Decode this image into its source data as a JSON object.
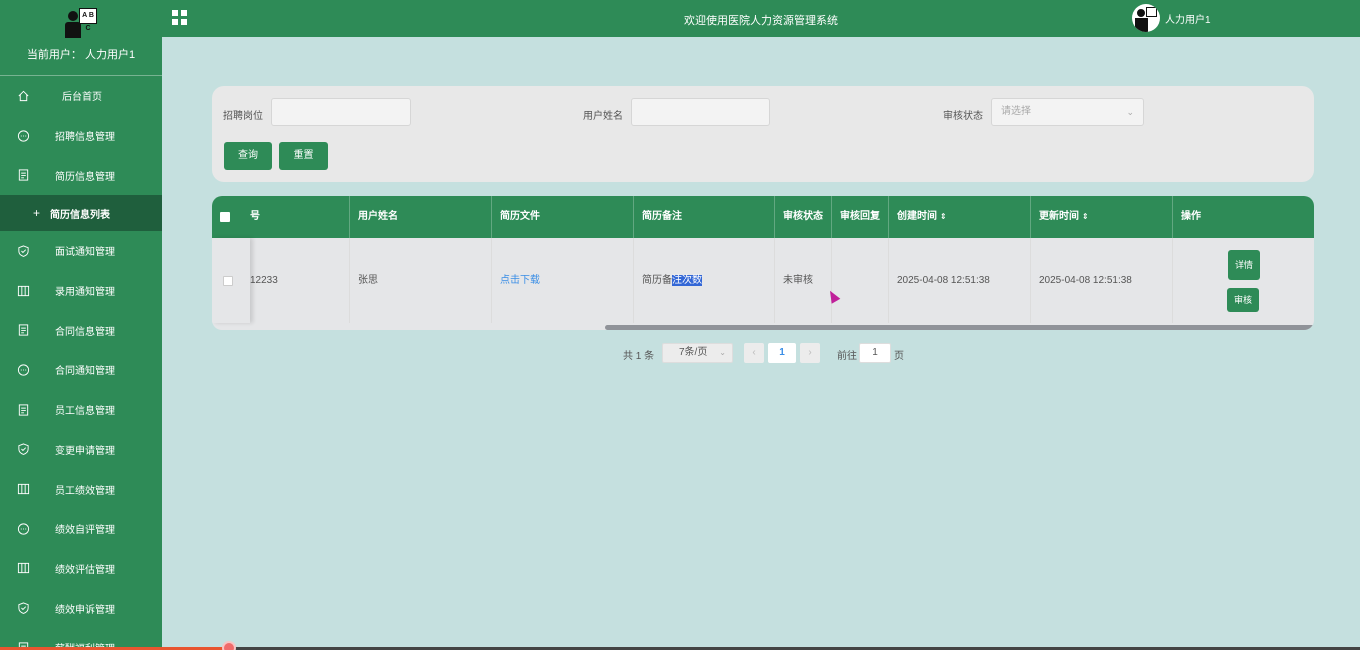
{
  "sidebar": {
    "current_user": "当前用户：  人力用户1",
    "logo_board": "A B C",
    "items": [
      {
        "label": "后台首页",
        "icon": "home-icon"
      },
      {
        "label": "招聘信息管理",
        "icon": "chat-bubble-icon"
      },
      {
        "label": "简历信息管理",
        "icon": "document-icon"
      },
      {
        "label": "面试通知管理",
        "icon": "shield-check-icon"
      },
      {
        "label": "录用通知管理",
        "icon": "columns-icon"
      },
      {
        "label": "合同信息管理",
        "icon": "document-icon"
      },
      {
        "label": "合同通知管理",
        "icon": "chat-bubble-icon"
      },
      {
        "label": "员工信息管理",
        "icon": "document-icon"
      },
      {
        "label": "变更申请管理",
        "icon": "shield-check-icon"
      },
      {
        "label": "员工绩效管理",
        "icon": "columns-icon"
      },
      {
        "label": "绩效自评管理",
        "icon": "chat-bubble-icon"
      },
      {
        "label": "绩效评估管理",
        "icon": "columns-icon"
      },
      {
        "label": "绩效申诉管理",
        "icon": "shield-check-icon"
      },
      {
        "label": "薪酬福利管理",
        "icon": "document-icon"
      }
    ],
    "sub_item": {
      "plus": "+",
      "label": "简历信息列表"
    }
  },
  "header": {
    "title": "欢迎使用医院人力资源管理系统",
    "user_name": "人力用户1"
  },
  "search": {
    "position_label": "招聘岗位",
    "position_value": "",
    "username_label": "用户姓名",
    "username_value": "",
    "status_label": "审核状态",
    "status_placeholder": "请选择",
    "query_button": "查询",
    "reset_button": "重置"
  },
  "table": {
    "columns": [
      "号",
      "用户姓名",
      "简历文件",
      "简历备注",
      "审核状态",
      "审核回复",
      "创建时间",
      "更新时间",
      "操作"
    ],
    "rows": [
      {
        "number": "12233",
        "username": "张思",
        "file_link": "点击下载",
        "remark_plain": "简历备",
        "remark_selected": "注次数",
        "status": "未审核",
        "reply": "",
        "created": "2025-04-08 12:51:38",
        "updated": "2025-04-08 12:51:38",
        "detail_button": "详情",
        "review_button": "审核"
      }
    ]
  },
  "pagination": {
    "total": "共 1 条",
    "page_size": "7条/页",
    "prev": "‹",
    "current": "1",
    "next": "›",
    "goto_label": "前往",
    "goto_value": "1",
    "goto_unit": "页"
  },
  "colors": {
    "primary": "#2e8b57",
    "dark_primary": "#1f5f3d",
    "background": "#c5e0df",
    "link": "#3a8ee6",
    "selection": "#3367d6"
  }
}
